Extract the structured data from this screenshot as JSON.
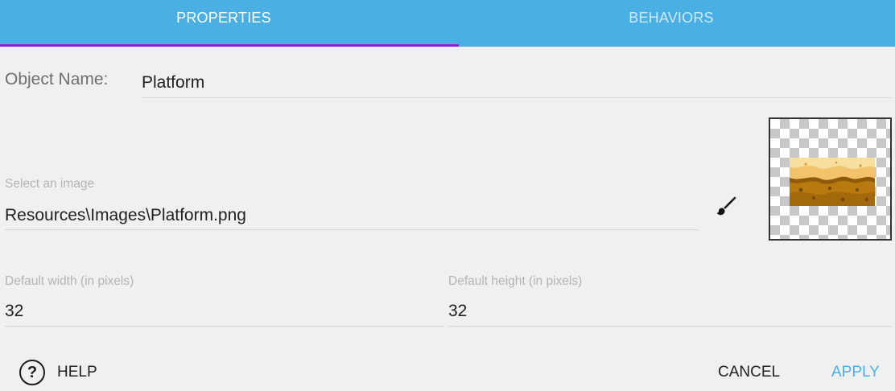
{
  "tabs": [
    {
      "label": "PROPERTIES",
      "active": true
    },
    {
      "label": "BEHAVIORS",
      "active": false
    }
  ],
  "object_name": {
    "label": "Object Name:",
    "value": "Platform"
  },
  "image_field": {
    "label": "Select an image",
    "value": "Resources\\Images\\Platform.png"
  },
  "width_field": {
    "label": "Default width (in pixels)",
    "value": "32"
  },
  "height_field": {
    "label": "Default height (in pixels)",
    "value": "32"
  },
  "icons": {
    "edit_image": "paintbrush-icon",
    "help": "help-circle-icon"
  },
  "footer": {
    "help_label": "HELP",
    "cancel_label": "CANCEL",
    "apply_label": "APPLY"
  },
  "colors": {
    "header": "#4ab0e4",
    "tab_indicator": "#8f1fd6",
    "apply": "#4ab0e4",
    "background": "#f0f0f0"
  }
}
